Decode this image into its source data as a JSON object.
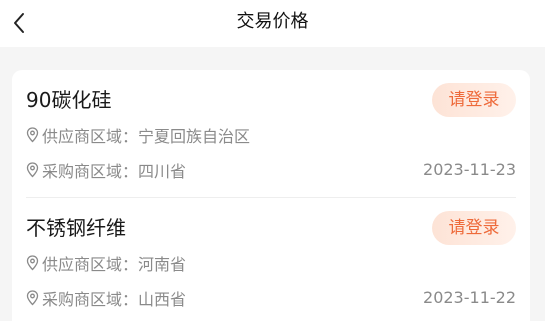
{
  "header": {
    "back_icon": "chevron-left-icon",
    "title": "交易价格"
  },
  "items": [
    {
      "name": "90碳化硅",
      "action_label": "请登录",
      "supplier_label": "供应商区域：",
      "supplier_region": "宁夏回族自治区",
      "buyer_label": "采购商区域：",
      "buyer_region": "四川省",
      "date": "2023-11-23"
    },
    {
      "name": "不锈钢纤维",
      "action_label": "请登录",
      "supplier_label": "供应商区域：",
      "supplier_region": "河南省",
      "buyer_label": "采购商区域：",
      "buyer_region": "山西省",
      "date": "2023-11-22"
    }
  ],
  "colors": {
    "accent": "#ee6a3a",
    "secondary_text": "#8a8a8a",
    "background": "#f5f5f5"
  }
}
